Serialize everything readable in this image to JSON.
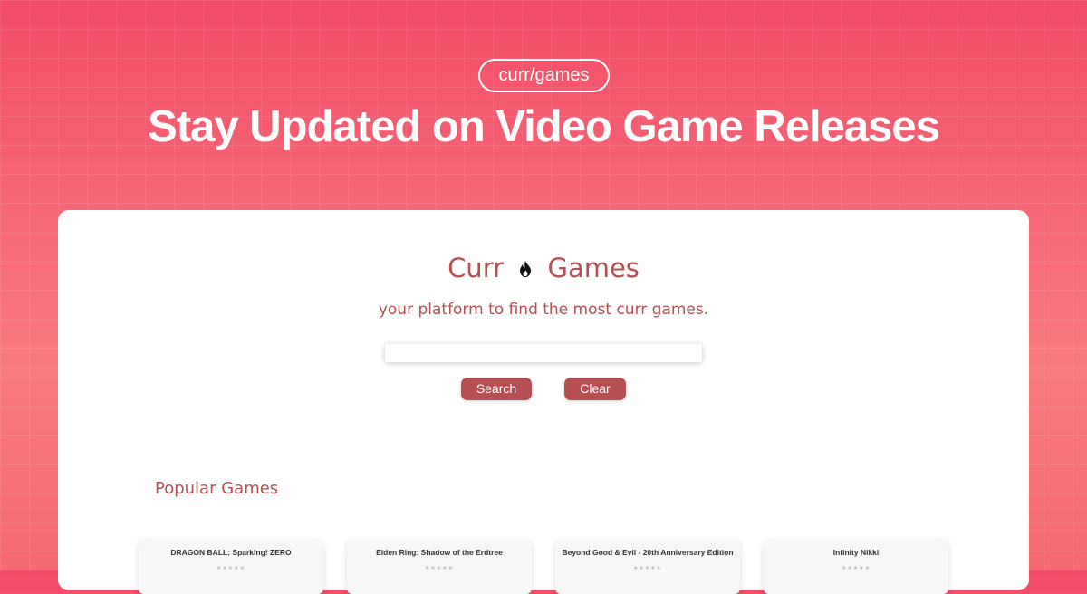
{
  "banner": {
    "pill": "curr/games",
    "title": "Stay Updated on Video Game Releases"
  },
  "app": {
    "title_left": "Curr",
    "title_right": "Games",
    "flame_icon": "flame-icon",
    "tagline": "your platform to find the most curr games.",
    "search": {
      "value": "",
      "placeholder": ""
    },
    "buttons": {
      "search": "Search",
      "clear": "Clear"
    },
    "section_title": "Popular Games",
    "games": [
      {
        "title": "DRAGON BALL: Sparking! ZERO"
      },
      {
        "title": "Elden Ring: Shadow of the Erdtree"
      },
      {
        "title": "Beyond Good & Evil - 20th Anniversary Edition"
      },
      {
        "title": "Infinity Nikki"
      }
    ]
  },
  "colors": {
    "accent": "#b54f52",
    "banner_top": "#f34c68",
    "banner_bottom": "#f36a70",
    "card_bg": "#ffffff"
  }
}
